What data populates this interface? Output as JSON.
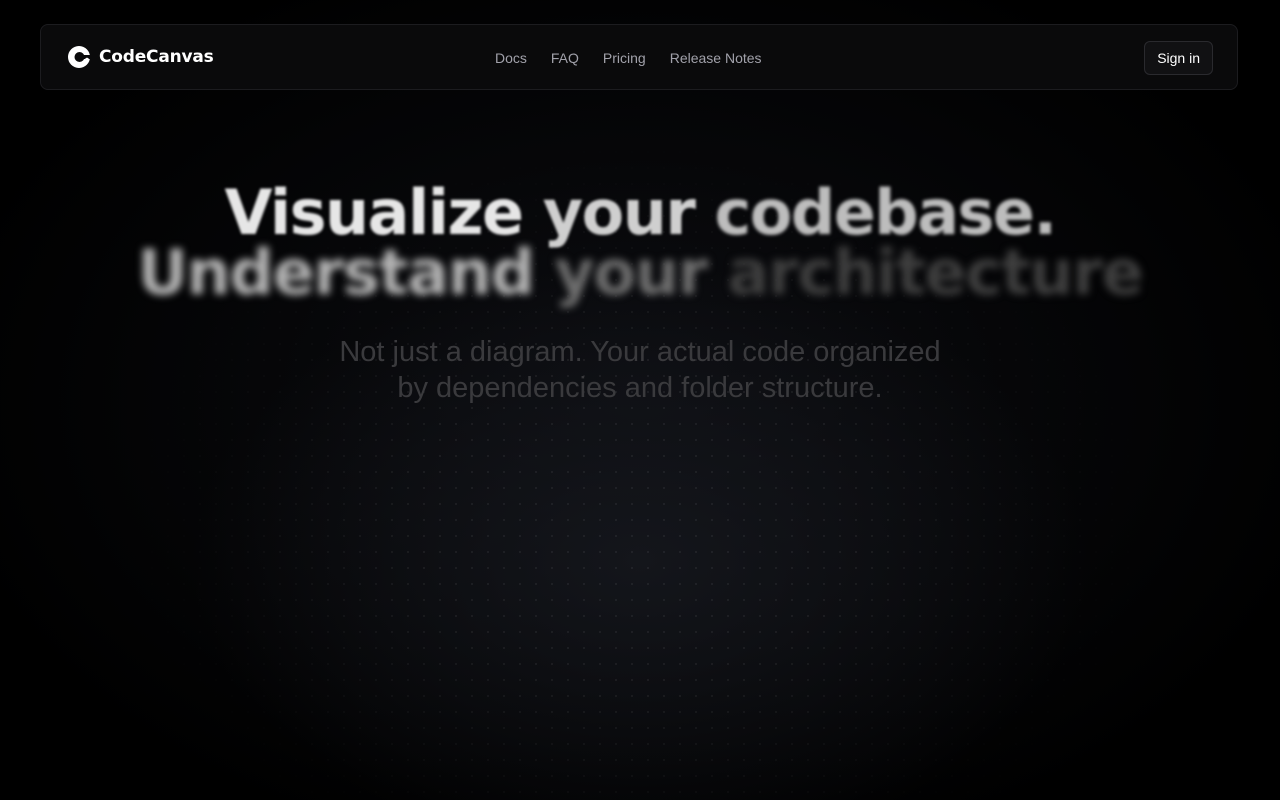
{
  "header": {
    "brand_name": "CodeCanvas",
    "logo_icon": "codecanvas-logo-icon",
    "nav": [
      {
        "label": "Docs"
      },
      {
        "label": "FAQ"
      },
      {
        "label": "Pricing"
      },
      {
        "label": "Release Notes"
      }
    ],
    "signin_label": "Sign in"
  },
  "hero": {
    "line1": [
      "Visualize",
      "your",
      "codebase."
    ],
    "line2": [
      "Understand",
      "your",
      "architecture"
    ],
    "subtitle_line1": "Not just a diagram. Your actual code organized",
    "subtitle_line2": "by dependencies and folder structure."
  },
  "colors": {
    "background": "#000000",
    "navbar_bg": "#0a0a0b",
    "nav_link": "#a1a1aa",
    "brand": "#ffffff"
  }
}
